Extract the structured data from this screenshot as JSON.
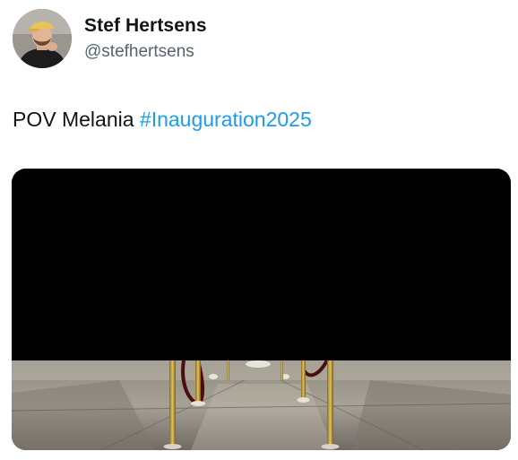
{
  "author": {
    "display_name": "Stef Hertsens",
    "handle": "@stefhertsens",
    "avatar_icon": "person-avatar-icon"
  },
  "post": {
    "text": "POV Melania",
    "hashtag": "#Inauguration2025",
    "hashtag_color": "#1d9bf0"
  },
  "media": {
    "type": "video",
    "icon": "video-frame-icon"
  },
  "colors": {
    "text": "#0f1419",
    "secondary": "#536471",
    "background": "#ffffff"
  }
}
